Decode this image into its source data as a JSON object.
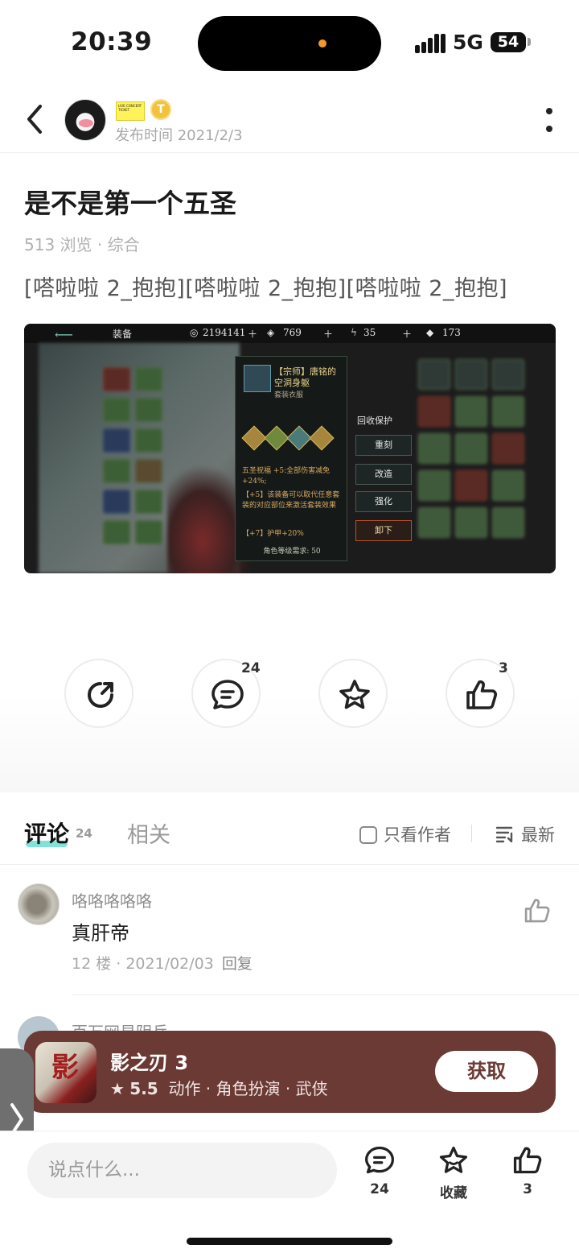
{
  "status_bar": {
    "time": "20:39",
    "network": "5G",
    "battery": "54"
  },
  "header": {
    "badge_ticket_text": "LIVE CONCERT TICKET",
    "badge_t": "T",
    "publish_time": "发布时间 2021/2/3"
  },
  "post": {
    "title": "是不是第一个五圣",
    "meta": "513 浏览 · 综合",
    "body": "[嗒啦啦 2_抱抱][嗒啦啦 2_抱抱][嗒啦啦 2_抱抱]"
  },
  "post_image": {
    "top_section": "装备",
    "top_gold": "2194141",
    "top_b": "769",
    "top_c": "35",
    "top_d": "173",
    "item_title": "【宗师】唐铭的空洞身躯",
    "item_type": "套装衣服",
    "set_bonus": "五圣祝福 +5:全部伤害减免+24%;",
    "plus_note": "【+5】该装备可以取代任意套装的对应部位来激活套装效果",
    "armor": "【+7】护甲+20%",
    "level_req": "角色等级需求: 50",
    "recycle": "回收保护",
    "btn_reforge": "重刻",
    "btn_modify": "改造",
    "btn_strengthen": "强化",
    "btn_unequip": "卸下"
  },
  "actions": {
    "comment_count": "24",
    "like_count": "3"
  },
  "tabs": {
    "comments_label": "评论",
    "comments_count": "24",
    "related_label": "相关",
    "author_only_label": "只看作者",
    "sort_label": "最新"
  },
  "comments": [
    {
      "name": "咯咯咯咯咯",
      "text": "真肝帝",
      "floor": "12 楼",
      "date": "2021/02/03",
      "reply_label": "回复"
    },
    {
      "name": "百万网易阴兵"
    }
  ],
  "game_banner": {
    "icon_glyph": "影",
    "title": "影之刃 3",
    "rating": "5.5",
    "tags": "动作 · 角色扮演 · 武侠",
    "get_label": "获取",
    "bg_color": "#6b3a35"
  },
  "bottom_bar": {
    "input_placeholder": "说点什么...",
    "comment_count": "24",
    "favorite_label": "收藏",
    "like_count": "3"
  },
  "colors": {
    "accent_underline": "#7fe3d8",
    "text_primary": "#1a1a1a",
    "text_secondary": "#a8a8a8"
  }
}
